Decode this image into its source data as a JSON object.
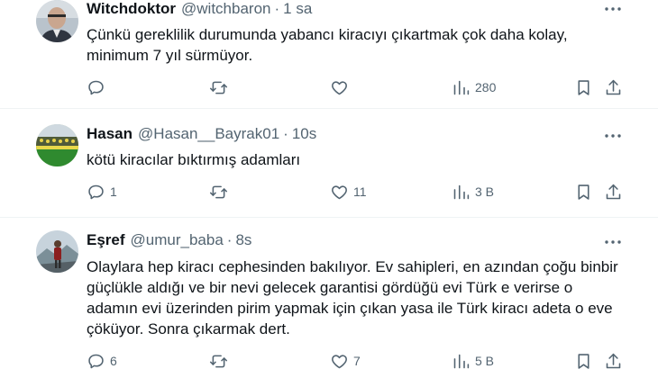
{
  "tweets": [
    {
      "name": "Witchdoktor",
      "handle": "@witchbaron",
      "separator": "·",
      "time": "1 sa",
      "text": "Çünkü gereklilik durumunda yabancı kiracıyı çıkartmak çok daha kolay, minimum 7 yıl sürmüyor.",
      "replies": "",
      "retweets": "",
      "likes": "",
      "views": "280"
    },
    {
      "name": "Hasan",
      "handle": "@Hasan__Bayrak01",
      "separator": "·",
      "time": "10s",
      "text": "kötü kiracılar bıktırmış adamları",
      "replies": "1",
      "retweets": "",
      "likes": "11",
      "views": "3 B"
    },
    {
      "name": "Eşref",
      "handle": "@umur_baba",
      "separator": "·",
      "time": "8s",
      "text": "Olaylara hep kiracı cephesinden bakılıyor. Ev sahipleri, en azından çoğu binbir güçlükle aldığı ve bir nevi gelecek garantisi gördüğü evi Türk e verirse o adamın evi üzerinden pirim yapmak için çıkan yasa ile Türk kiracı adeta o eve çöküyor. Sonra çıkarmak dert.",
      "replies": "6",
      "retweets": "",
      "likes": "7",
      "views": "5 B"
    }
  ],
  "icons": {
    "more": "more-horizontal-icon",
    "reply": "reply-bubble-icon",
    "retweet": "retweet-arrows-icon",
    "like": "heart-icon",
    "views": "analytics-bars-icon",
    "bookmark": "bookmark-icon",
    "share": "share-upload-icon"
  },
  "colors": {
    "text": "#0f1419",
    "secondary": "#536471",
    "divider": "#eff3f4"
  }
}
